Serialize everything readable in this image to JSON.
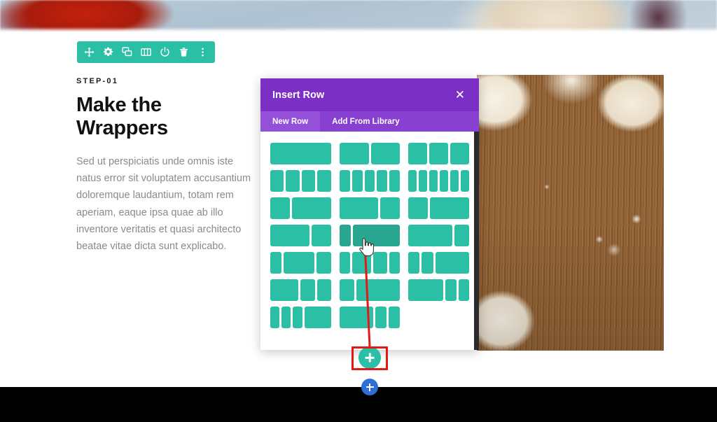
{
  "page": {
    "top_image_alt": "blurred food photo strip",
    "right_image_alt": "dough balls on floured wooden cutting board"
  },
  "module_toolbar": {
    "icons": [
      {
        "name": "move-icon",
        "title": "Move"
      },
      {
        "name": "gear-icon",
        "title": "Settings"
      },
      {
        "name": "duplicate-icon",
        "title": "Duplicate"
      },
      {
        "name": "columns-icon",
        "title": "Change Column Structure"
      },
      {
        "name": "power-icon",
        "title": "Disable"
      },
      {
        "name": "trash-icon",
        "title": "Delete"
      },
      {
        "name": "kebab-menu-icon",
        "title": "More Options"
      }
    ],
    "background_color": "#2bbfa5"
  },
  "content": {
    "step_label": "STEP-01",
    "headline": "Make the Wrappers",
    "body": "Sed ut perspiciatis unde omnis iste natus error sit voluptatem accusantium doloremque laudantium, totam rem aperiam, eaque ipsa quae ab illo inventore veritatis et quasi architecto beatae vitae dicta sunt explicabo."
  },
  "modal": {
    "title": "Insert Row",
    "close_label": "✕",
    "header_color": "#7b2fc4",
    "tabs": [
      {
        "label": "New Row",
        "active": true
      },
      {
        "label": "Add From Library",
        "active": false
      }
    ],
    "block_color": "#2bbfa5",
    "block_hover_color": "#28a690",
    "layouts": [
      {
        "index": 0,
        "columns": [
          100
        ],
        "hovered": false
      },
      {
        "index": 1,
        "columns": [
          50,
          50
        ],
        "hovered": false
      },
      {
        "index": 2,
        "columns": [
          33,
          33,
          33
        ],
        "hovered": false
      },
      {
        "index": 3,
        "columns": [
          25,
          25,
          25,
          25
        ],
        "hovered": false
      },
      {
        "index": 4,
        "columns": [
          20,
          20,
          20,
          20,
          20
        ],
        "hovered": false
      },
      {
        "index": 5,
        "columns": [
          16,
          16,
          16,
          16,
          16,
          16
        ],
        "hovered": false
      },
      {
        "index": 6,
        "columns": [
          33,
          66
        ],
        "hovered": false
      },
      {
        "index": 7,
        "columns": [
          66,
          33
        ],
        "hovered": false
      },
      {
        "index": 8,
        "columns": [
          33,
          66
        ],
        "hovered": false
      },
      {
        "index": 9,
        "columns": [
          66,
          33
        ],
        "hovered": false
      },
      {
        "index": 10,
        "columns": [
          20,
          80
        ],
        "hovered": true
      },
      {
        "index": 11,
        "columns": [
          75,
          25
        ],
        "hovered": false
      },
      {
        "index": 12,
        "columns": [
          20,
          55,
          25
        ],
        "hovered": false
      },
      {
        "index": 13,
        "columns": [
          20,
          35,
          25,
          20
        ],
        "hovered": false
      },
      {
        "index": 14,
        "columns": [
          20,
          20,
          60
        ],
        "hovered": false
      },
      {
        "index": 15,
        "columns": [
          50,
          25,
          25
        ],
        "hovered": false
      },
      {
        "index": 16,
        "columns": [
          25,
          75
        ],
        "hovered": false
      },
      {
        "index": 17,
        "columns": [
          62,
          19,
          19
        ],
        "hovered": false
      },
      {
        "index": 18,
        "columns": [
          17,
          17,
          17,
          49
        ],
        "hovered": false
      },
      {
        "index": 19,
        "columns": [
          60,
          20,
          20
        ],
        "hovered": false
      },
      {
        "index": 20,
        "columns": [],
        "hovered": false
      }
    ]
  },
  "annotation": {
    "color": "#e01b17",
    "target": "add-row-button"
  },
  "buttons": {
    "add_row_title": "Add New Row",
    "add_row_color": "#2bbfa5",
    "add_section_title": "Add New Section",
    "add_section_color": "#2d6fd4"
  }
}
